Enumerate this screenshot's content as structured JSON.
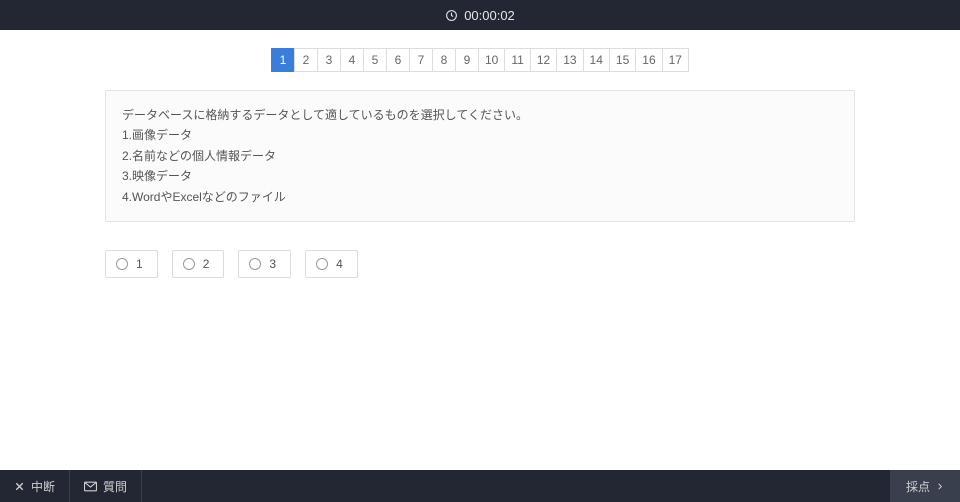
{
  "header": {
    "timer": "00:00:02"
  },
  "pager": {
    "items": [
      "1",
      "2",
      "3",
      "4",
      "5",
      "6",
      "7",
      "8",
      "9",
      "10",
      "11",
      "12",
      "13",
      "14",
      "15",
      "16",
      "17"
    ],
    "active_index": 0
  },
  "question": {
    "lines": [
      "データベースに格納するデータとして適しているものを選択してください。",
      "1.画像データ",
      "2.名前などの個人情報データ",
      "3.映像データ",
      "4.WordやExcelなどのファイル"
    ]
  },
  "answers": {
    "options": [
      "1",
      "2",
      "3",
      "4"
    ]
  },
  "footer": {
    "abort": "中断",
    "question": "質問",
    "grade": "採点"
  }
}
